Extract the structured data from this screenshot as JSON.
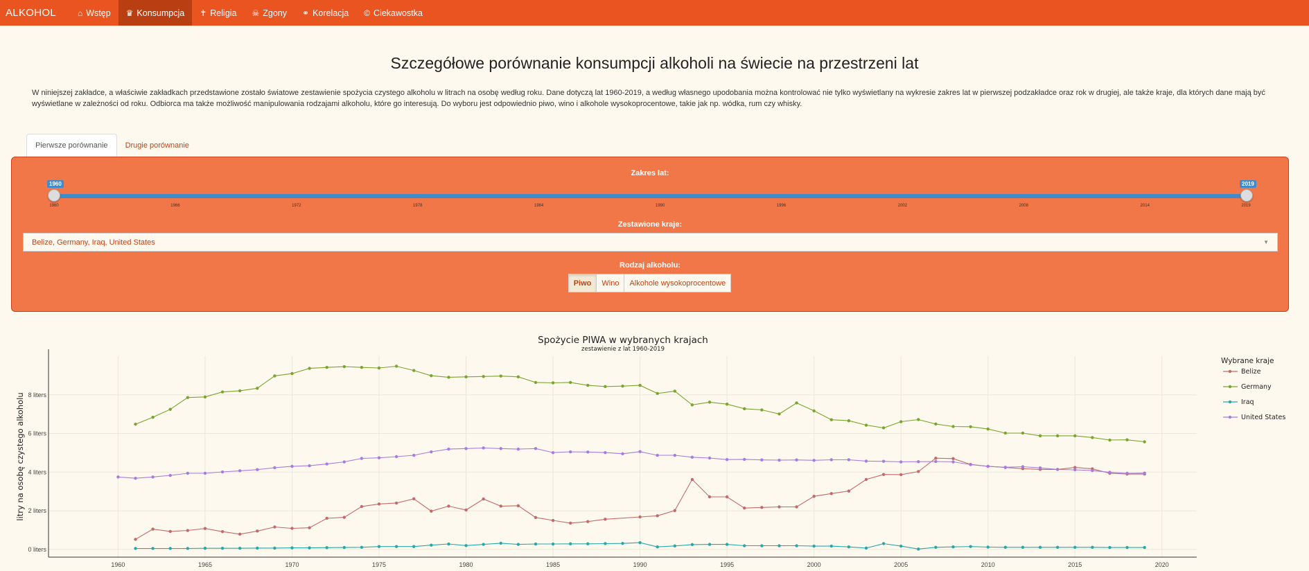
{
  "navbar": {
    "brand": "ALKOHOL",
    "items": [
      {
        "label": "Wstęp",
        "icon": "⌂",
        "icon_name": "home-icon",
        "active": false
      },
      {
        "label": "Konsumpcja",
        "icon": "♛",
        "icon_name": "crown-icon",
        "active": true
      },
      {
        "label": "Religia",
        "icon": "✝",
        "icon_name": "cross-icon",
        "active": false
      },
      {
        "label": "Zgony",
        "icon": "☠",
        "icon_name": "skull-icon",
        "active": false
      },
      {
        "label": "Korelacja",
        "icon": "⚭",
        "icon_name": "link-icon",
        "active": false
      },
      {
        "label": "Ciekawostka",
        "icon": "©",
        "icon_name": "copyright-icon",
        "active": false
      }
    ]
  },
  "page": {
    "title": "Szczegółowe porównanie konsumpcji alkoholi na świecie na przestrzeni lat",
    "intro": "W niniejszej zakładce, a właściwie zakładkach przedstawione zostało światowe zestawienie spożycia czystego alkoholu w litrach na osobę według roku. Dane dotyczą lat 1960-2019, a według własnego upodobania można kontrolować nie tylko wyświetlany na wykresie zakres lat w pierwszej podzakładce oraz rok w drugiej, ale także kraje, dla których dane mają być wyświetlane w zależności od roku. Odbiorca ma także możliwość manipulowania rodzajami alkoholu, które go interesują. Do wyboru jest odpowiednio piwo, wino i alkohole wysokoprocentowe, takie jak np. wódka, rum czy whisky."
  },
  "tabs": [
    {
      "label": "Pierwsze porównanie",
      "active": true
    },
    {
      "label": "Drugie porównanie",
      "active": false
    }
  ],
  "controls": {
    "year_label": "Zakres lat:",
    "year_min": "1960",
    "year_max": "2019",
    "ticks": [
      "1960",
      "1966",
      "1972",
      "1978",
      "1984",
      "1990",
      "1996",
      "2002",
      "2008",
      "2014",
      "2019"
    ],
    "countries_label": "Zestawione kraje:",
    "countries_value": "Belize, Germany, Iraq, United States",
    "alcohol_label": "Rodzaj alkoholu:",
    "alcohol_options": [
      {
        "label": "Piwo",
        "active": true
      },
      {
        "label": "Wino",
        "active": false
      },
      {
        "label": "Alkohole wysokoprocentowe",
        "active": false
      }
    ]
  },
  "chart_data": {
    "type": "line",
    "title": "Spożycie PIWA w wybranych krajach",
    "subtitle": "zestawienie z lat 1960-2019",
    "xlabel": "",
    "ylabel": "litry na osobę czystego alkoholu",
    "xlim": [
      1956,
      2022
    ],
    "ylim": [
      -0.4,
      10
    ],
    "xticks": [
      1960,
      1965,
      1970,
      1975,
      1980,
      1985,
      1990,
      1995,
      2000,
      2005,
      2010,
      2015,
      2020
    ],
    "yticks": [
      0,
      2,
      4,
      6,
      8
    ],
    "ytick_labels": [
      "0 liters",
      "2 liters",
      "4 liters",
      "6 liters",
      "8 liters"
    ],
    "grid": true,
    "legend_title": "Wybrane kraje",
    "legend_position": "right",
    "series": [
      {
        "name": "Belize",
        "color": "#c36a6a",
        "x": [
          1961,
          1962,
          1963,
          1964,
          1965,
          1966,
          1967,
          1968,
          1969,
          1970,
          1971,
          1972,
          1973,
          1974,
          1975,
          1976,
          1977,
          1978,
          1979,
          1980,
          1981,
          1982,
          1983,
          1984,
          1985,
          1986,
          1987,
          1988,
          1990,
          1991,
          1992,
          1993,
          1994,
          1995,
          1996,
          1997,
          1998,
          1999,
          2000,
          2001,
          2002,
          2003,
          2004,
          2005,
          2006,
          2007,
          2008,
          2009,
          2010,
          2011,
          2012,
          2013,
          2014,
          2015,
          2016,
          2017,
          2018,
          2019
        ],
        "y": [
          0.52,
          1.05,
          0.93,
          0.98,
          1.08,
          0.92,
          0.79,
          0.95,
          1.16,
          1.09,
          1.12,
          1.61,
          1.66,
          2.22,
          2.35,
          2.4,
          2.62,
          1.98,
          2.24,
          2.04,
          2.61,
          2.24,
          2.26,
          1.65,
          1.5,
          1.36,
          1.44,
          1.56,
          1.68,
          1.74,
          2.01,
          3.62,
          2.72,
          2.72,
          2.14,
          2.17,
          2.2,
          2.2,
          2.75,
          2.89,
          3.02,
          3.62,
          3.88,
          3.87,
          4.03,
          4.72,
          4.7,
          4.4,
          4.3,
          4.24,
          4.18,
          4.14,
          4.14,
          4.24,
          4.17,
          3.94,
          3.9,
          3.9
        ]
      },
      {
        "name": "Germany",
        "color": "#7aa52e",
        "x": [
          1961,
          1962,
          1963,
          1964,
          1965,
          1966,
          1967,
          1968,
          1969,
          1970,
          1971,
          1972,
          1973,
          1974,
          1975,
          1976,
          1977,
          1978,
          1979,
          1980,
          1981,
          1982,
          1983,
          1984,
          1985,
          1986,
          1987,
          1988,
          1989,
          1990,
          1991,
          1992,
          1993,
          1994,
          1995,
          1996,
          1997,
          1998,
          1999,
          2000,
          2001,
          2002,
          2003,
          2004,
          2005,
          2006,
          2007,
          2008,
          2009,
          2010,
          2011,
          2012,
          2013,
          2014,
          2015,
          2016,
          2017,
          2018,
          2019
        ],
        "y": [
          6.48,
          6.84,
          7.25,
          7.86,
          7.89,
          8.15,
          8.21,
          8.34,
          8.98,
          9.1,
          9.37,
          9.42,
          9.46,
          9.42,
          9.39,
          9.48,
          9.26,
          8.99,
          8.91,
          8.93,
          8.95,
          8.97,
          8.93,
          8.64,
          8.62,
          8.64,
          8.49,
          8.43,
          8.45,
          8.49,
          8.07,
          8.19,
          7.48,
          7.62,
          7.52,
          7.28,
          7.22,
          7.01,
          7.58,
          7.17,
          6.71,
          6.66,
          6.43,
          6.29,
          6.61,
          6.72,
          6.49,
          6.36,
          6.35,
          6.23,
          6.02,
          6.02,
          5.88,
          5.88,
          5.88,
          5.79,
          5.66,
          5.67,
          5.57
        ]
      },
      {
        "name": "Iraq",
        "color": "#27a8a8",
        "x": [
          1961,
          1962,
          1963,
          1964,
          1965,
          1966,
          1967,
          1968,
          1969,
          1970,
          1971,
          1972,
          1973,
          1974,
          1975,
          1976,
          1977,
          1978,
          1979,
          1980,
          1981,
          1982,
          1983,
          1984,
          1985,
          1986,
          1987,
          1988,
          1989,
          1990,
          1991,
          1992,
          1993,
          1994,
          1995,
          1996,
          1997,
          1998,
          1999,
          2000,
          2001,
          2002,
          2003,
          2004,
          2005,
          2006,
          2007,
          2008,
          2009,
          2010,
          2011,
          2012,
          2013,
          2014,
          2015,
          2016,
          2017,
          2018,
          2019
        ],
        "y": [
          0.05,
          0.05,
          0.05,
          0.05,
          0.06,
          0.06,
          0.06,
          0.07,
          0.07,
          0.08,
          0.08,
          0.09,
          0.1,
          0.11,
          0.15,
          0.15,
          0.15,
          0.22,
          0.28,
          0.2,
          0.26,
          0.32,
          0.26,
          0.28,
          0.28,
          0.29,
          0.29,
          0.3,
          0.31,
          0.35,
          0.13,
          0.18,
          0.25,
          0.26,
          0.26,
          0.19,
          0.19,
          0.19,
          0.19,
          0.17,
          0.17,
          0.13,
          0.07,
          0.3,
          0.17,
          0.02,
          0.11,
          0.13,
          0.15,
          0.12,
          0.11,
          0.11,
          0.11,
          0.11,
          0.11,
          0.11,
          0.1,
          0.1,
          0.1
        ]
      },
      {
        "name": "United States",
        "color": "#a77be0",
        "x": [
          1960,
          1961,
          1962,
          1963,
          1964,
          1965,
          1966,
          1967,
          1968,
          1969,
          1970,
          1971,
          1972,
          1973,
          1974,
          1975,
          1976,
          1977,
          1978,
          1979,
          1980,
          1981,
          1982,
          1983,
          1984,
          1985,
          1986,
          1987,
          1988,
          1989,
          1990,
          1991,
          1992,
          1993,
          1994,
          1995,
          1996,
          1997,
          1998,
          1999,
          2000,
          2001,
          2002,
          2003,
          2004,
          2005,
          2006,
          2007,
          2008,
          2009,
          2010,
          2011,
          2012,
          2013,
          2014,
          2015,
          2016,
          2017,
          2018,
          2019
        ],
        "y": [
          3.75,
          3.68,
          3.75,
          3.83,
          3.94,
          3.94,
          4.01,
          4.07,
          4.13,
          4.23,
          4.3,
          4.33,
          4.42,
          4.53,
          4.71,
          4.74,
          4.8,
          4.87,
          5.05,
          5.19,
          5.22,
          5.25,
          5.22,
          5.19,
          5.22,
          5.01,
          5.05,
          5.04,
          5.01,
          4.95,
          5.06,
          4.87,
          4.87,
          4.77,
          4.73,
          4.65,
          4.66,
          4.63,
          4.62,
          4.63,
          4.61,
          4.64,
          4.64,
          4.57,
          4.56,
          4.53,
          4.54,
          4.55,
          4.53,
          4.39,
          4.3,
          4.25,
          4.28,
          4.22,
          4.14,
          4.12,
          4.08,
          3.99,
          3.94,
          3.95
        ]
      }
    ]
  }
}
